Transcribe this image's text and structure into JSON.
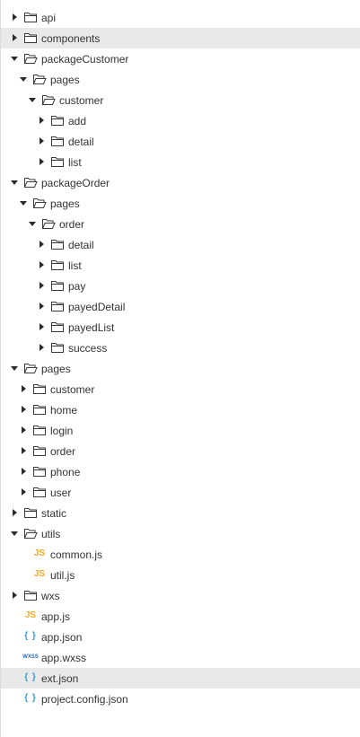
{
  "colors": {
    "highlight_row": "#e9e9e9",
    "js_icon": "#f0a92e",
    "json_icon": "#2a9fd6",
    "wxss_icon": "#2269b8",
    "text": "#333333"
  },
  "icon_glyphs": {
    "js": "JS",
    "json": "{ }",
    "wxss": "WXSS"
  },
  "tree": [
    {
      "label": "api",
      "type": "folder",
      "expanded": false,
      "depth": 0,
      "highlight": false
    },
    {
      "label": "components",
      "type": "folder",
      "expanded": false,
      "depth": 0,
      "highlight": true
    },
    {
      "label": "packageCustomer",
      "type": "folder",
      "expanded": true,
      "depth": 0,
      "highlight": false
    },
    {
      "label": "pages",
      "type": "folder",
      "expanded": true,
      "depth": 1,
      "highlight": false
    },
    {
      "label": "customer",
      "type": "folder",
      "expanded": true,
      "depth": 2,
      "highlight": false
    },
    {
      "label": "add",
      "type": "folder",
      "expanded": false,
      "depth": 3,
      "highlight": false
    },
    {
      "label": "detail",
      "type": "folder",
      "expanded": false,
      "depth": 3,
      "highlight": false
    },
    {
      "label": "list",
      "type": "folder",
      "expanded": false,
      "depth": 3,
      "highlight": false
    },
    {
      "label": "packageOrder",
      "type": "folder",
      "expanded": true,
      "depth": 0,
      "highlight": false
    },
    {
      "label": "pages",
      "type": "folder",
      "expanded": true,
      "depth": 1,
      "highlight": false
    },
    {
      "label": "order",
      "type": "folder",
      "expanded": true,
      "depth": 2,
      "highlight": false
    },
    {
      "label": "detail",
      "type": "folder",
      "expanded": false,
      "depth": 3,
      "highlight": false
    },
    {
      "label": "list",
      "type": "folder",
      "expanded": false,
      "depth": 3,
      "highlight": false
    },
    {
      "label": "pay",
      "type": "folder",
      "expanded": false,
      "depth": 3,
      "highlight": false
    },
    {
      "label": "payedDetail",
      "type": "folder",
      "expanded": false,
      "depth": 3,
      "highlight": false
    },
    {
      "label": "payedList",
      "type": "folder",
      "expanded": false,
      "depth": 3,
      "highlight": false
    },
    {
      "label": "success",
      "type": "folder",
      "expanded": false,
      "depth": 3,
      "highlight": false
    },
    {
      "label": "pages",
      "type": "folder",
      "expanded": true,
      "depth": 0,
      "highlight": false
    },
    {
      "label": "customer",
      "type": "folder",
      "expanded": false,
      "depth": 1,
      "highlight": false
    },
    {
      "label": "home",
      "type": "folder",
      "expanded": false,
      "depth": 1,
      "highlight": false
    },
    {
      "label": "login",
      "type": "folder",
      "expanded": false,
      "depth": 1,
      "highlight": false
    },
    {
      "label": "order",
      "type": "folder",
      "expanded": false,
      "depth": 1,
      "highlight": false
    },
    {
      "label": "phone",
      "type": "folder",
      "expanded": false,
      "depth": 1,
      "highlight": false
    },
    {
      "label": "user",
      "type": "folder",
      "expanded": false,
      "depth": 1,
      "highlight": false
    },
    {
      "label": "static",
      "type": "folder",
      "expanded": false,
      "depth": 0,
      "highlight": false
    },
    {
      "label": "utils",
      "type": "folder",
      "expanded": true,
      "depth": 0,
      "highlight": false
    },
    {
      "label": "common.js",
      "type": "js",
      "depth": 1,
      "highlight": false
    },
    {
      "label": "util.js",
      "type": "js",
      "depth": 1,
      "highlight": false
    },
    {
      "label": "wxs",
      "type": "folder",
      "expanded": false,
      "depth": 0,
      "highlight": false
    },
    {
      "label": "app.js",
      "type": "js",
      "depth": 0,
      "highlight": false
    },
    {
      "label": "app.json",
      "type": "json",
      "depth": 0,
      "highlight": false
    },
    {
      "label": "app.wxss",
      "type": "wxss",
      "depth": 0,
      "highlight": false
    },
    {
      "label": "ext.json",
      "type": "json",
      "depth": 0,
      "highlight": true
    },
    {
      "label": "project.config.json",
      "type": "json",
      "depth": 0,
      "highlight": false
    }
  ]
}
